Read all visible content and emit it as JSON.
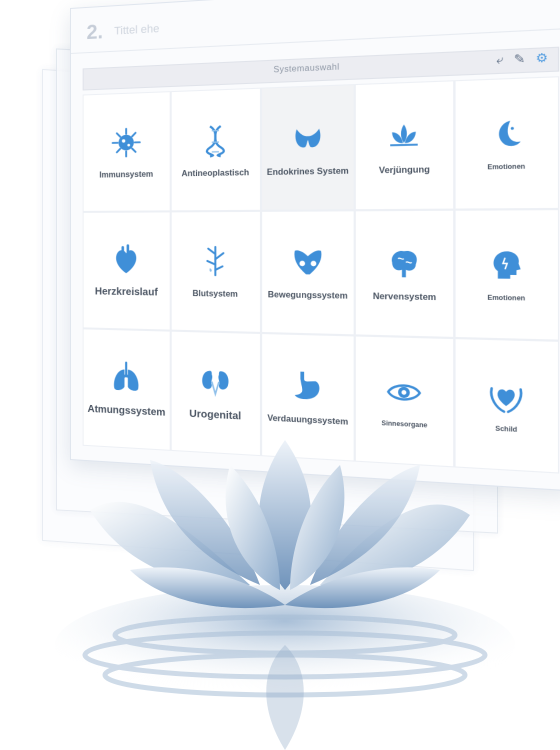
{
  "window": {
    "step_number": "2.",
    "step_label": "Tittel ehe"
  },
  "toolbar": {
    "title": "Systemauswahl",
    "icons": [
      "back-arrow-icon",
      "edit-pen-icon",
      "settings-icon"
    ]
  },
  "tiles": [
    {
      "label": "Immunsystem",
      "icon": "virus-icon"
    },
    {
      "label": "Antineoplastisch",
      "icon": "dna-icon"
    },
    {
      "label": "Endokrines System",
      "icon": "thyroid-icon",
      "selected": true
    },
    {
      "label": "Verjüngung",
      "icon": "lotus-icon"
    },
    {
      "label": "Emotionen",
      "icon": "moon-face-icon"
    },
    {
      "label": "Herzkreislauf",
      "icon": "heart-icon"
    },
    {
      "label": "Blutsystem",
      "icon": "blood-vessels-icon"
    },
    {
      "label": "Bewegungssystem",
      "icon": "pelvis-icon"
    },
    {
      "label": "Nervensystem",
      "icon": "brain-icon"
    },
    {
      "label": "Emotionen",
      "icon": "head-mind-icon"
    },
    {
      "label": "Atmungssystem",
      "icon": "lungs-icon"
    },
    {
      "label": "Urogenital",
      "icon": "kidneys-icon"
    },
    {
      "label": "Verdauungssystem",
      "icon": "stomach-icon"
    },
    {
      "label": "Sinnesorgane",
      "icon": "eye-icon"
    },
    {
      "label": "Schild",
      "icon": "hands-heart-icon"
    }
  ],
  "colors": {
    "accent": "#4f9be0",
    "icon": "#3f8fd8",
    "lotus_petal": "#7fa3c8",
    "lotus_light": "#e6eef7"
  }
}
